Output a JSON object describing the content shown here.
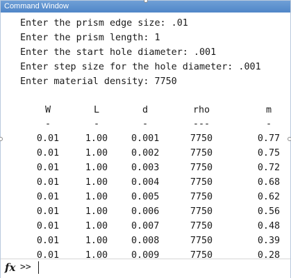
{
  "window": {
    "title": "Command Window"
  },
  "output_lines": [
    "Enter the prism edge size: .01",
    "Enter the prism length: 1",
    "Enter the start hole diameter: .001",
    "Enter step size for the hole diameter: .001",
    "Enter material density: 7750"
  ],
  "table": {
    "headers": [
      "W",
      "L",
      "d",
      "rho",
      "m"
    ],
    "underlines": [
      "-",
      "-",
      "-",
      "---",
      "-"
    ],
    "rows": [
      [
        "0.01",
        "1.00",
        "0.001",
        "7750",
        "0.77"
      ],
      [
        "0.01",
        "1.00",
        "0.002",
        "7750",
        "0.75"
      ],
      [
        "0.01",
        "1.00",
        "0.003",
        "7750",
        "0.72"
      ],
      [
        "0.01",
        "1.00",
        "0.004",
        "7750",
        "0.68"
      ],
      [
        "0.01",
        "1.00",
        "0.005",
        "7750",
        "0.62"
      ],
      [
        "0.01",
        "1.00",
        "0.006",
        "7750",
        "0.56"
      ],
      [
        "0.01",
        "1.00",
        "0.007",
        "7750",
        "0.48"
      ],
      [
        "0.01",
        "1.00",
        "0.008",
        "7750",
        "0.39"
      ],
      [
        "0.01",
        "1.00",
        "0.009",
        "7750",
        "0.28"
      ]
    ]
  },
  "command_line": {
    "fx_label": "fx",
    "prompt": ">>",
    "input_value": ""
  }
}
